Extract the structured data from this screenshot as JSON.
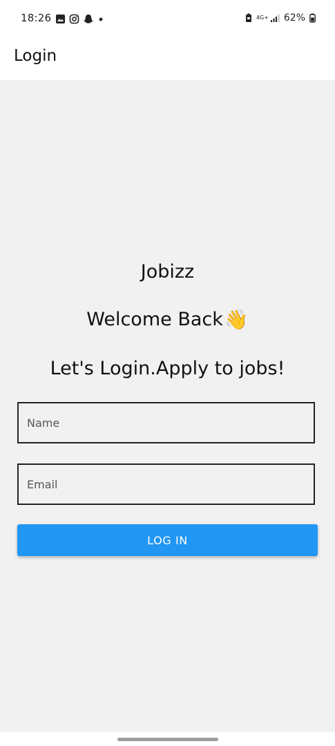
{
  "status_bar": {
    "time": "18:26",
    "left_icons": [
      "gallery-icon",
      "instagram-icon",
      "snapchat-icon",
      "notification-dot-icon"
    ],
    "right_icons": [
      "battery-saver-icon",
      "4g-icon",
      "signal-icon",
      "battery-icon"
    ],
    "network": "4G+",
    "battery": "62%"
  },
  "app_bar": {
    "title": "Login"
  },
  "main": {
    "app_name": "Jobizz",
    "welcome": "Welcome Back",
    "welcome_emoji": "👋",
    "tagline": "Let's Login.Apply to jobs!"
  },
  "form": {
    "name_placeholder": "Name",
    "email_placeholder": "Email",
    "login_label": "LOG IN"
  },
  "colors": {
    "accent": "#2196f3",
    "background": "#f1f1f1",
    "bar": "#ffffff"
  }
}
